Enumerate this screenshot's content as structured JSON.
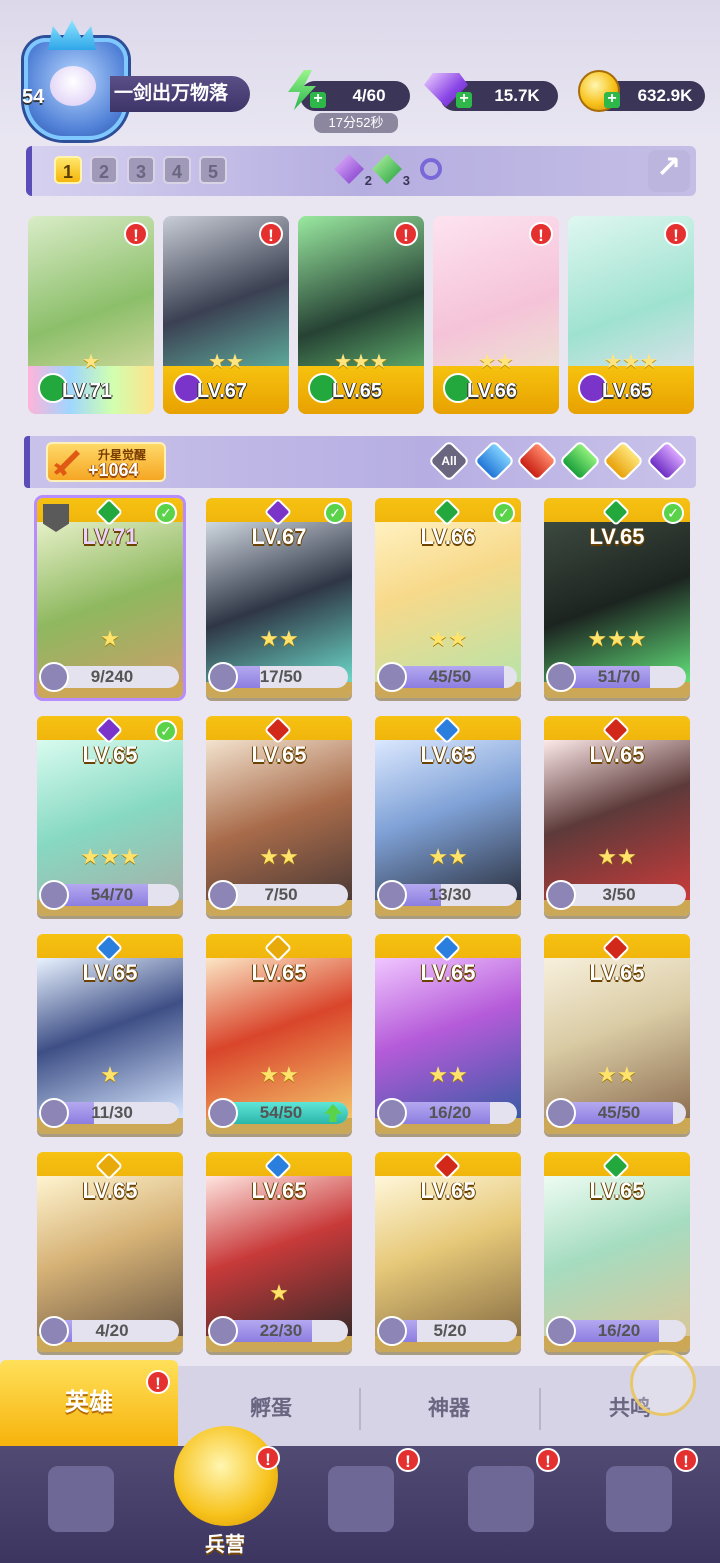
{
  "player": {
    "level": "54",
    "name": "一剑出万物落"
  },
  "resources": {
    "energy": "4/60",
    "energy_timer": "17分52秒",
    "gems": "15.7K",
    "gold": "632.9K"
  },
  "lineup": {
    "slots": [
      "1",
      "2",
      "3",
      "4",
      "5"
    ],
    "active_slot": "1",
    "dark_count": "2",
    "nature_count": "3"
  },
  "team": [
    {
      "level": "LV.71",
      "element": "nature",
      "stars": "★",
      "alert": "!"
    },
    {
      "level": "LV.67",
      "element": "dark",
      "stars": "★★",
      "alert": "!"
    },
    {
      "level": "LV.65",
      "element": "nature",
      "stars": "★★★",
      "alert": "!"
    },
    {
      "level": "LV.66",
      "element": "nature",
      "stars": "★★",
      "alert": "!"
    },
    {
      "level": "LV.65",
      "element": "dark",
      "stars": "★★★",
      "alert": "!"
    }
  ],
  "awaken": {
    "label": "升星觉醒",
    "value": "+1064"
  },
  "filters": {
    "all": "All",
    "elements": [
      "water",
      "fire",
      "nature",
      "light",
      "dark"
    ]
  },
  "heroes": [
    {
      "level": "LV.71",
      "element": "nature",
      "stars": "★",
      "shards": "9/240",
      "progress": 0.0375,
      "checked": true
    },
    {
      "level": "LV.67",
      "element": "dark",
      "stars": "★★",
      "shards": "17/50",
      "progress": 0.34,
      "checked": true
    },
    {
      "level": "LV.66",
      "element": "nature",
      "stars": "★★",
      "shards": "45/50",
      "progress": 0.9,
      "checked": true
    },
    {
      "level": "LV.65",
      "element": "nature",
      "stars": "★★★",
      "shards": "51/70",
      "progress": 0.7286,
      "checked": true
    },
    {
      "level": "LV.65",
      "element": "dark",
      "stars": "★★★",
      "shards": "54/70",
      "progress": 0.7714,
      "checked": true
    },
    {
      "level": "LV.65",
      "element": "fire",
      "stars": "★★",
      "shards": "7/50",
      "progress": 0.14,
      "checked": false
    },
    {
      "level": "LV.65",
      "element": "water",
      "stars": "★★",
      "shards": "13/30",
      "progress": 0.4333,
      "checked": false
    },
    {
      "level": "LV.65",
      "element": "fire",
      "stars": "★★",
      "shards": "3/50",
      "progress": 0.06,
      "checked": false
    },
    {
      "level": "LV.65",
      "element": "water",
      "stars": "★",
      "shards": "11/30",
      "progress": 0.3667,
      "checked": false
    },
    {
      "level": "LV.65",
      "element": "light",
      "stars": "★★",
      "shards": "54/50",
      "progress": 1.0,
      "checked": false
    },
    {
      "level": "LV.65",
      "element": "water",
      "stars": "★★",
      "shards": "16/20",
      "progress": 0.8,
      "checked": false
    },
    {
      "level": "LV.65",
      "element": "fire",
      "stars": "★★",
      "shards": "45/50",
      "progress": 0.9,
      "checked": false
    },
    {
      "level": "LV.65",
      "element": "light",
      "stars": "",
      "shards": "4/20",
      "progress": 0.2,
      "checked": false
    },
    {
      "level": "LV.65",
      "element": "water",
      "stars": "★",
      "shards": "22/30",
      "progress": 0.7333,
      "checked": false
    },
    {
      "level": "LV.65",
      "element": "fire",
      "stars": "",
      "shards": "5/20",
      "progress": 0.25,
      "checked": false
    },
    {
      "level": "LV.65",
      "element": "nature",
      "stars": "",
      "shards": "16/20",
      "progress": 0.8,
      "checked": false
    }
  ],
  "tabs": {
    "heroes": "英雄",
    "hatch": "孵蛋",
    "artifacts": "神器",
    "resonance": "共鸣",
    "alert": "!"
  },
  "nav": {
    "barracks": "兵营",
    "alert": "!"
  },
  "colors": {
    "nature": "#23a83e",
    "dark": "#7a34c9",
    "fire": "#d2281a",
    "water": "#2a7fde",
    "light": "#e8a90a",
    "gold": "#f6b70c",
    "panel": "#3b3558"
  }
}
